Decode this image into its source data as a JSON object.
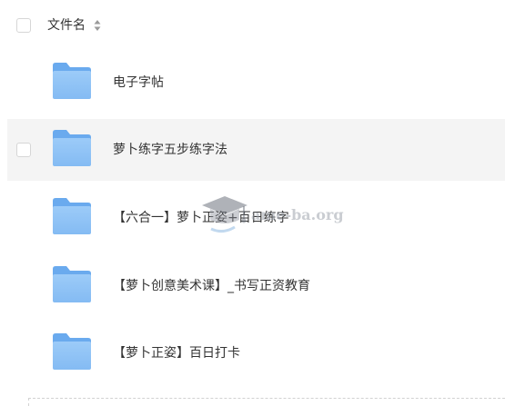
{
  "header": {
    "column_label": "文件名",
    "sort_icon": "sort-toggle-icon"
  },
  "files": [
    {
      "name": "电子字帖",
      "icon": "folder-icon"
    },
    {
      "name": "萝卜练字五步练字法",
      "icon": "folder-icon"
    },
    {
      "name": "【六合一】萝卜正姿+百日练字",
      "icon": "folder-icon"
    },
    {
      "name": "【萝卜创意美术课】_书写正资教育",
      "icon": "folder-icon"
    },
    {
      "name": "【萝卜正姿】百日打卡",
      "icon": "folder-icon"
    }
  ],
  "watermark": {
    "text": "ame-ba.org",
    "icon": "graduation-cap-icon"
  },
  "colors": {
    "folder_light": "#8ec1f6",
    "folder_dark": "#6aaaee",
    "row_hover": "#f4f4f4",
    "text": "#333333"
  }
}
